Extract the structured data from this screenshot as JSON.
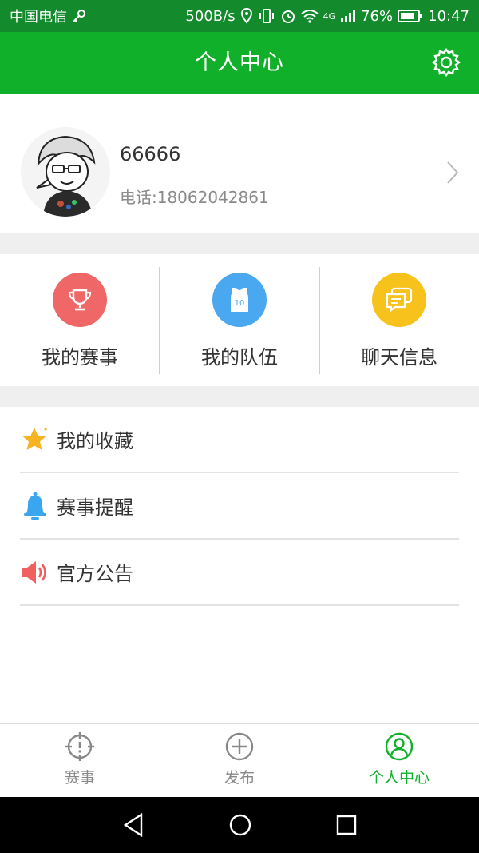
{
  "status_bar": {
    "carrier": "中国电信",
    "speed": "500B/s",
    "network": "4G",
    "battery": "76%",
    "time": "10:47"
  },
  "header": {
    "title": "个人中心",
    "settings_icon": "gear-icon"
  },
  "profile": {
    "username": "66666",
    "phone": "电话:18062042861",
    "avatar_icon": "avatar-illustration"
  },
  "quick_actions": [
    {
      "label": "我的赛事",
      "icon": "trophy-icon",
      "color": "#f06767"
    },
    {
      "label": "我的队伍",
      "icon": "jersey-icon",
      "color": "#4aa8f0",
      "badge": "10"
    },
    {
      "label": "聊天信息",
      "icon": "chat-icon",
      "color": "#f7c21b"
    }
  ],
  "menu": [
    {
      "label": "我的收藏",
      "icon": "star-icon",
      "color": "#f7b422"
    },
    {
      "label": "赛事提醒",
      "icon": "bell-icon",
      "color": "#3aa6f0"
    },
    {
      "label": "官方公告",
      "icon": "speaker-icon",
      "color": "#f06060"
    }
  ],
  "tabs": [
    {
      "label": "赛事",
      "icon": "target-icon",
      "active": false
    },
    {
      "label": "发布",
      "icon": "plus-circle-icon",
      "active": false
    },
    {
      "label": "个人中心",
      "icon": "user-circle-icon",
      "active": true
    }
  ],
  "colors": {
    "accent": "#10b02a",
    "status_bar": "#138a2c",
    "separator": "#efefef"
  }
}
